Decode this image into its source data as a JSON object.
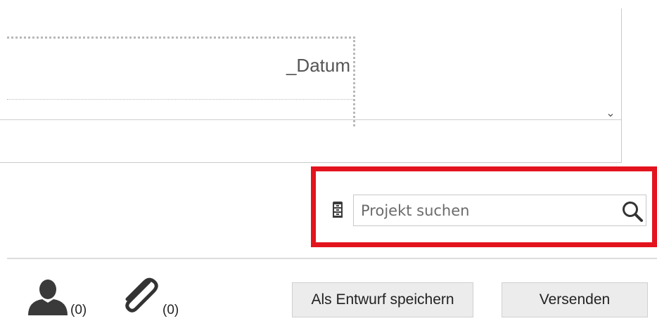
{
  "editor": {
    "template_field_text": "_Datum",
    "scroll_down_glyph": "⌄"
  },
  "project_search": {
    "placeholder": "Projekt suchen",
    "value": "",
    "project_icon": "file-cabinet-icon",
    "search_icon": "search-icon",
    "highlight_color": "#e3141e"
  },
  "footer": {
    "recipient_icon": "person-icon",
    "recipient_count": "(0)",
    "attachment_icon": "paperclip-icon",
    "attachment_count": "(0)",
    "save_draft_label": "Als Entwurf speichern",
    "send_label": "Versenden"
  }
}
